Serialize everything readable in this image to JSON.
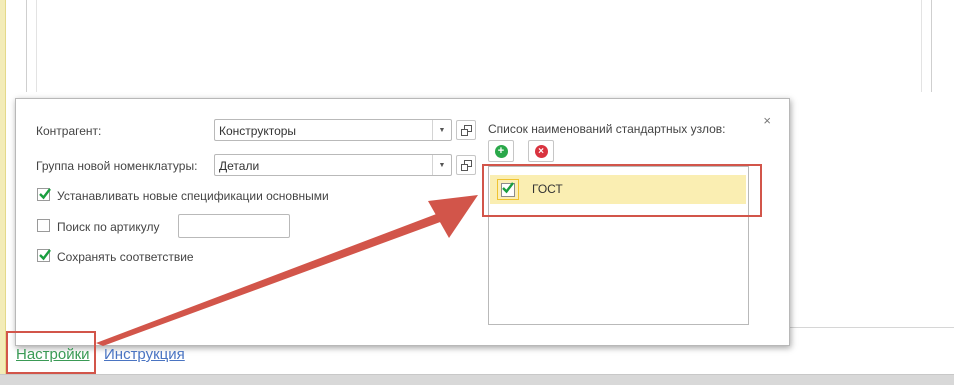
{
  "form": {
    "contractor_label": "Контрагент:",
    "contractor_value": "Конструкторы",
    "group_label": "Группа новой номенклатуры:",
    "group_value": "Детали",
    "set_specs_label": "Устанавливать новые спецификации основными",
    "set_specs_checked": true,
    "search_article_label": "Поиск по артикулу",
    "search_article_checked": false,
    "search_article_value": "",
    "save_match_label": "Сохранять соответствие",
    "save_match_checked": true
  },
  "std_nodes": {
    "title": "Список наименований стандартных узлов:",
    "items": [
      {
        "label": "ГОСТ",
        "checked": true
      }
    ]
  },
  "close_symbol": "×",
  "links": {
    "settings": "Настройки",
    "instruction": "Инструкция"
  },
  "colors": {
    "check_green": "#1a9e3f",
    "add_green": "#2aa84a",
    "delete_red": "#d9333f",
    "highlight_red": "#d2554a",
    "selected_row": "#faeeb2"
  },
  "icons": {
    "add": "plus-circle-icon",
    "delete": "x-circle-icon",
    "open": "open-window-icon",
    "dropdown": "triangle-down-icon"
  }
}
